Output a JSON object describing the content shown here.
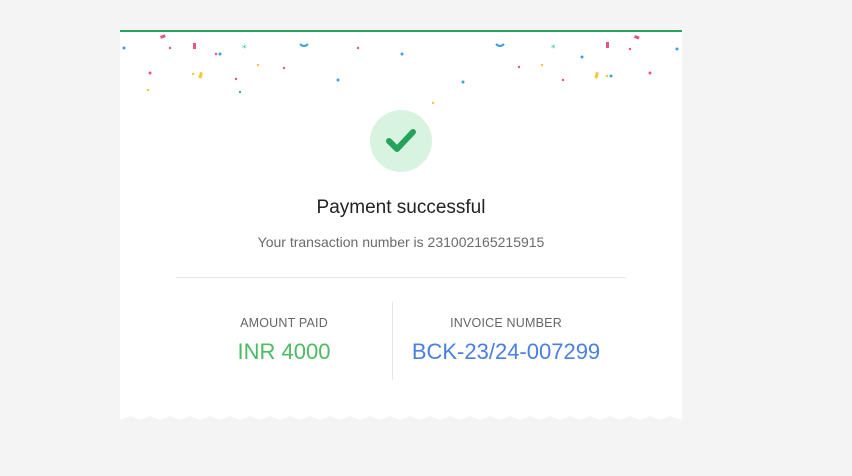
{
  "status": {
    "title": "Payment successful",
    "transaction_text": "Your transaction number is 231002165215915"
  },
  "details": {
    "amount_label": "AMOUNT PAID",
    "amount_value": "INR 4000",
    "invoice_label": "INVOICE NUMBER",
    "invoice_value": "BCK-23/24-007299"
  },
  "colors": {
    "accent_green": "#27a35f",
    "amount_green": "#4cbb63",
    "invoice_blue": "#4a7fe0",
    "check_bg": "#d8f3df"
  },
  "icons": {
    "success": "check-icon",
    "decoration": "confetti"
  }
}
